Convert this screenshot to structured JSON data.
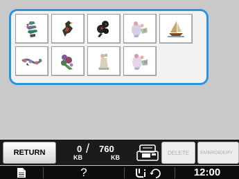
{
  "panel": {
    "thumbnails": [
      {
        "icon": "embroidery-design-1-icon"
      },
      {
        "icon": "embroidery-design-2-icon"
      },
      {
        "icon": "embroidery-design-3-icon"
      },
      {
        "icon": "embroidery-design-4-icon"
      },
      {
        "icon": "embroidery-design-5-icon"
      },
      {
        "icon": "embroidery-design-6-icon"
      },
      {
        "icon": "embroidery-design-7-icon"
      },
      {
        "icon": "embroidery-design-8-icon"
      },
      {
        "icon": "embroidery-design-9-icon"
      }
    ],
    "border_color": "#2a95dd"
  },
  "toolbar": {
    "return_label": "RETURN",
    "memory_used": "0",
    "memory_used_unit": "KB",
    "memory_total": "760",
    "memory_total_unit": "KB",
    "slash": "/",
    "delete_label": "DELETE",
    "embroidery_label": "EMBROIDERY"
  },
  "statusbar": {
    "document_icon": "document-icon",
    "help_label": "?",
    "settings_icon": "machine-settings-icon",
    "clock": "12:00"
  }
}
